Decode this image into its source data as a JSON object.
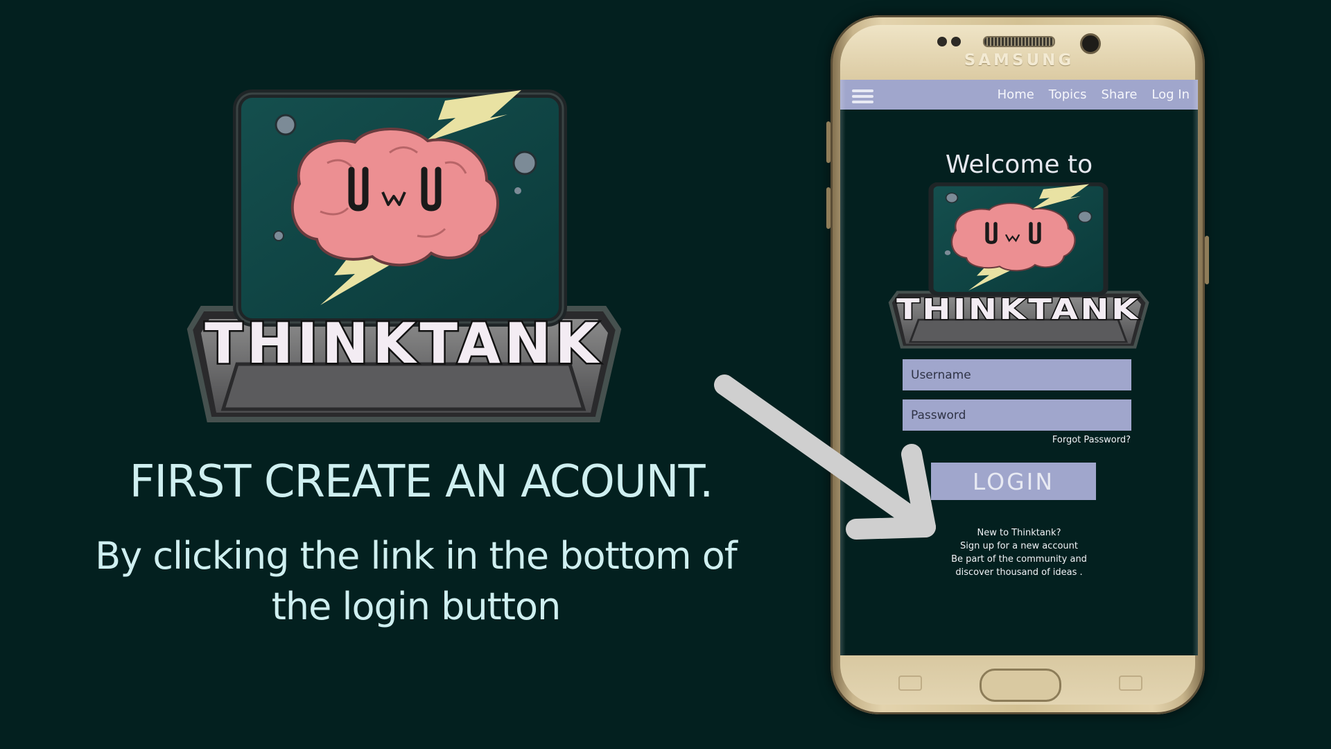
{
  "left": {
    "logo_text": "THINKTANK",
    "title": "FIRST CREATE AN ACOUNT.",
    "subtitle_line1": "By clicking the link in the bottom of",
    "subtitle_line2": "the login button"
  },
  "phone": {
    "brand": "SAMSUNG",
    "nav": {
      "home": "Home",
      "topics": "Topics",
      "share": "Share",
      "login": "Log In"
    },
    "welcome": "Welcome to",
    "logo_text": "THINKTANK",
    "username_placeholder": "Username",
    "password_placeholder": "Password",
    "forgot": "Forgot Password?",
    "login_button": "LOGIN",
    "new_to": "New to Thinktank?",
    "signup": "Sign up for a new account",
    "community_line1": "Be part of the community and",
    "community_line2": "discover thousand of ideas ."
  },
  "colors": {
    "background": "#03201f",
    "accent": "#a0a6cc",
    "caption_text": "#cfeff0",
    "brain": "#ec8f92",
    "bolt": "#e9e2a3",
    "tank_glass": "#0e4545"
  },
  "icons": [
    "menu-icon",
    "arrow-icon",
    "brain-icon",
    "lightning-bolt-icon",
    "bubble-icon"
  ]
}
